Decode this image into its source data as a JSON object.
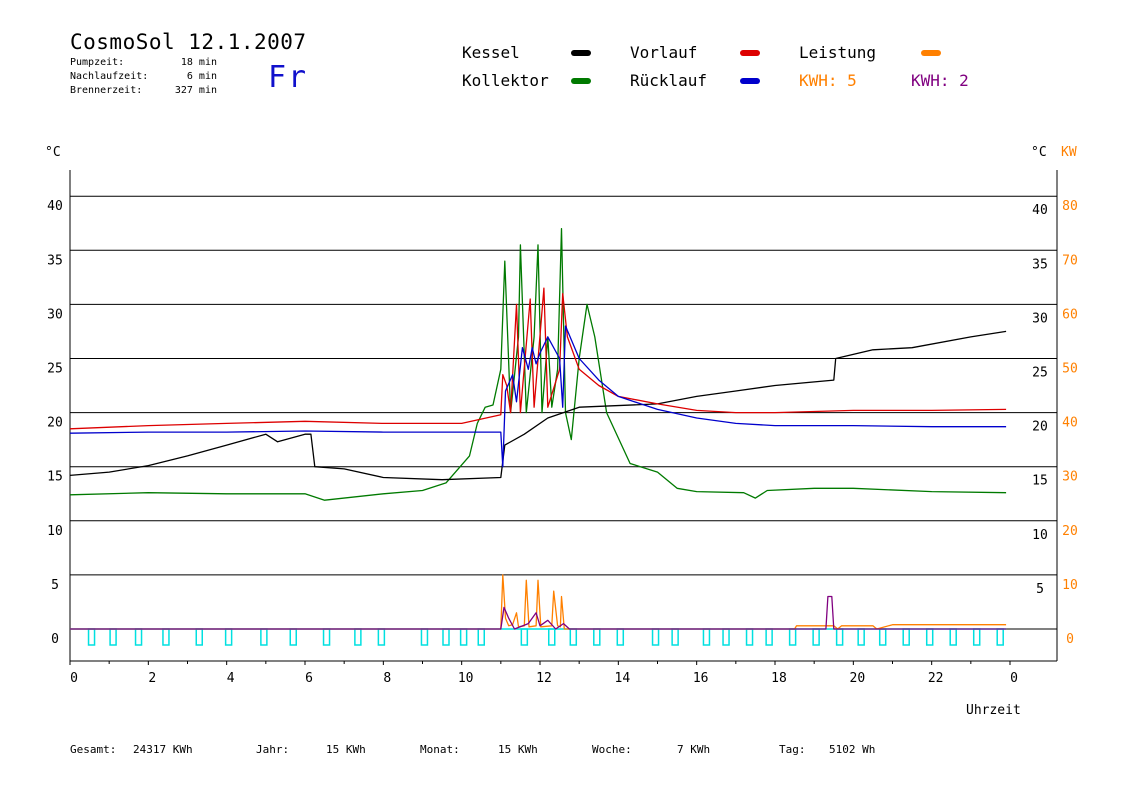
{
  "header": {
    "title": "CosmoSol 12.1.2007",
    "day": "Fr",
    "info": [
      {
        "label": "Pumpzeit:",
        "value": "18 min"
      },
      {
        "label": "Nachlaufzeit:",
        "value": "6 min"
      },
      {
        "label": "Brennerzeit:",
        "value": "327 min"
      }
    ]
  },
  "legend": {
    "kessel": "Kessel",
    "kollektor": "Kollektor",
    "vorlauf": "Vorlauf",
    "ruecklauf": "Rücklauf",
    "leistung": "Leistung",
    "kwh1": "KWH: 5",
    "kwh2": "KWH: 2"
  },
  "footer": {
    "gesamt_label": "Gesamt:",
    "gesamt_value": "24317 KWh",
    "jahr_label": "Jahr:",
    "jahr_value": "15 KWh",
    "monat_label": "Monat:",
    "monat_value": "15 KWh",
    "woche_label": "Woche:",
    "woche_value": "7 KWh",
    "tag_label": "Tag:",
    "tag_value": "5102 Wh"
  },
  "chart_data": {
    "type": "line",
    "xlabel": "Uhrzeit",
    "y_left_unit": "°C",
    "y_right_unit_c": "°C",
    "y_right_unit_kw": "KW",
    "x_ticks": [
      "0",
      "2",
      "4",
      "6",
      "8",
      "10",
      "12",
      "14",
      "16",
      "18",
      "20",
      "22",
      "0"
    ],
    "y_left_ticks": [
      "0",
      "5",
      "10",
      "15",
      "20",
      "25",
      "30",
      "35",
      "40"
    ],
    "y_right_c_ticks": [
      "5",
      "10",
      "15",
      "20",
      "25",
      "30",
      "35",
      "40"
    ],
    "y_right_kw_ticks": [
      "0",
      "10",
      "20",
      "30",
      "40",
      "50",
      "60",
      "70",
      "80"
    ],
    "xlim": [
      0,
      24
    ],
    "ylim": [
      0,
      40
    ],
    "colors": {
      "kessel": "#000000",
      "kollektor": "#007a00",
      "vorlauf": "#dd0000",
      "ruecklauf": "#0000cc",
      "leistung": "#ff8000",
      "kwh2": "#800080",
      "pumpe": "#00e0e0"
    },
    "series": [
      {
        "name": "Kessel",
        "key": "kessel",
        "points": [
          [
            0,
            14.2
          ],
          [
            1,
            14.5
          ],
          [
            2,
            15.1
          ],
          [
            3,
            16
          ],
          [
            4,
            17
          ],
          [
            5,
            18
          ],
          [
            5.3,
            17.3
          ],
          [
            6,
            18
          ],
          [
            6.15,
            18
          ],
          [
            6.25,
            15
          ],
          [
            7,
            14.8
          ],
          [
            8,
            14
          ],
          [
            9.5,
            13.8
          ],
          [
            11,
            14
          ],
          [
            11.1,
            17
          ],
          [
            11.6,
            18
          ],
          [
            12.2,
            19.5
          ],
          [
            12.6,
            20
          ],
          [
            13,
            20.5
          ],
          [
            15,
            20.8
          ],
          [
            16,
            21.5
          ],
          [
            17,
            22
          ],
          [
            18,
            22.5
          ],
          [
            19.5,
            23
          ],
          [
            19.55,
            25
          ],
          [
            20.5,
            25.8
          ],
          [
            21.5,
            26
          ],
          [
            23,
            27
          ],
          [
            23.9,
            27.5
          ]
        ]
      },
      {
        "name": "Kollektor",
        "key": "kollektor",
        "points": [
          [
            0,
            12.4
          ],
          [
            2,
            12.6
          ],
          [
            4,
            12.5
          ],
          [
            6,
            12.5
          ],
          [
            6.5,
            11.9
          ],
          [
            8,
            12.5
          ],
          [
            9,
            12.8
          ],
          [
            9.6,
            13.5
          ],
          [
            10.2,
            16
          ],
          [
            10.4,
            19
          ],
          [
            10.6,
            20.5
          ],
          [
            10.8,
            20.7
          ],
          [
            11,
            24
          ],
          [
            11.1,
            34
          ],
          [
            11.25,
            20
          ],
          [
            11.45,
            27
          ],
          [
            11.5,
            35.5
          ],
          [
            11.65,
            20
          ],
          [
            11.85,
            27
          ],
          [
            11.95,
            35.5
          ],
          [
            12.05,
            20
          ],
          [
            12.2,
            27
          ],
          [
            12.3,
            20.5
          ],
          [
            12.45,
            24
          ],
          [
            12.55,
            37
          ],
          [
            12.65,
            20
          ],
          [
            12.8,
            17.5
          ],
          [
            13,
            25
          ],
          [
            13.2,
            30
          ],
          [
            13.4,
            27
          ],
          [
            13.7,
            20
          ],
          [
            14.3,
            15.3
          ],
          [
            15,
            14.5
          ],
          [
            15.5,
            13
          ],
          [
            16,
            12.7
          ],
          [
            17.2,
            12.6
          ],
          [
            17.5,
            12.1
          ],
          [
            17.8,
            12.8
          ],
          [
            19,
            13
          ],
          [
            20,
            13
          ],
          [
            22,
            12.7
          ],
          [
            23.9,
            12.6
          ]
        ]
      },
      {
        "name": "Vorlauf",
        "key": "vorlauf",
        "points": [
          [
            0,
            18.5
          ],
          [
            2,
            18.8
          ],
          [
            4,
            19
          ],
          [
            6,
            19.2
          ],
          [
            8,
            19
          ],
          [
            10,
            19
          ],
          [
            11,
            19.8
          ],
          [
            11.05,
            23.5
          ],
          [
            11.15,
            22.5
          ],
          [
            11.25,
            20
          ],
          [
            11.4,
            30
          ],
          [
            11.5,
            20
          ],
          [
            11.75,
            30.5
          ],
          [
            11.85,
            20.5
          ],
          [
            12.1,
            31.5
          ],
          [
            12.2,
            20.5
          ],
          [
            12.5,
            24
          ],
          [
            12.58,
            31
          ],
          [
            12.7,
            27
          ],
          [
            13,
            24
          ],
          [
            13.5,
            22.5
          ],
          [
            14,
            21.5
          ],
          [
            15,
            20.8
          ],
          [
            16,
            20.2
          ],
          [
            17,
            20
          ],
          [
            18,
            20
          ],
          [
            20,
            20.2
          ],
          [
            22,
            20.2
          ],
          [
            23.9,
            20.3
          ]
        ]
      },
      {
        "name": "Rücklauf",
        "key": "ruecklauf",
        "points": [
          [
            0,
            18.1
          ],
          [
            2,
            18.2
          ],
          [
            4,
            18.2
          ],
          [
            6,
            18.3
          ],
          [
            8,
            18.2
          ],
          [
            10,
            18.2
          ],
          [
            11,
            18.2
          ],
          [
            11.05,
            15
          ],
          [
            11.12,
            22
          ],
          [
            11.3,
            23.5
          ],
          [
            11.4,
            21
          ],
          [
            11.55,
            26
          ],
          [
            11.7,
            24
          ],
          [
            11.8,
            26
          ],
          [
            11.9,
            24.5
          ],
          [
            12,
            25.5
          ],
          [
            12.2,
            27
          ],
          [
            12.5,
            25
          ],
          [
            12.58,
            20.5
          ],
          [
            12.65,
            28
          ],
          [
            13,
            25
          ],
          [
            13.5,
            23
          ],
          [
            14,
            21.5
          ],
          [
            15,
            20.3
          ],
          [
            16,
            19.5
          ],
          [
            17,
            19
          ],
          [
            18,
            18.8
          ],
          [
            20,
            18.8
          ],
          [
            22,
            18.7
          ],
          [
            23.9,
            18.7
          ]
        ]
      },
      {
        "name": "Leistung",
        "key": "leistung",
        "points": [
          [
            0,
            0
          ],
          [
            11,
            0
          ],
          [
            11.05,
            5
          ],
          [
            11.12,
            1
          ],
          [
            11.2,
            0.3
          ],
          [
            11.3,
            0.4
          ],
          [
            11.4,
            1.5
          ],
          [
            11.45,
            0.2
          ],
          [
            11.6,
            0.3
          ],
          [
            11.65,
            4.5
          ],
          [
            11.72,
            0.2
          ],
          [
            11.9,
            0.3
          ],
          [
            11.95,
            4.5
          ],
          [
            12.02,
            0.2
          ],
          [
            12.3,
            0.3
          ],
          [
            12.35,
            3.5
          ],
          [
            12.45,
            0.3
          ],
          [
            12.52,
            0.2
          ],
          [
            12.55,
            3
          ],
          [
            12.62,
            0
          ],
          [
            18.5,
            0
          ],
          [
            18.55,
            0.3
          ],
          [
            19.5,
            0.3
          ],
          [
            19.6,
            0
          ],
          [
            19.7,
            0.3
          ],
          [
            20.5,
            0.3
          ],
          [
            20.6,
            0
          ],
          [
            21,
            0.4
          ],
          [
            23.9,
            0.4
          ]
        ]
      },
      {
        "name": "KWH",
        "key": "kwh2",
        "points": [
          [
            0,
            0
          ],
          [
            11,
            0
          ],
          [
            11.08,
            2
          ],
          [
            11.2,
            1
          ],
          [
            11.35,
            0
          ],
          [
            11.7,
            0.5
          ],
          [
            11.9,
            1.5
          ],
          [
            12,
            0.3
          ],
          [
            12.2,
            0.8
          ],
          [
            12.4,
            0
          ],
          [
            12.6,
            0.5
          ],
          [
            12.75,
            0
          ],
          [
            19.3,
            0
          ],
          [
            19.35,
            3
          ],
          [
            19.45,
            3
          ],
          [
            19.5,
            0
          ],
          [
            23.9,
            0
          ]
        ]
      },
      {
        "name": "Pumpe",
        "key": "pumpe",
        "pulses": [
          0.55,
          1.1,
          1.75,
          2.45,
          3.3,
          4.05,
          4.95,
          5.7,
          6.55,
          7.35,
          7.95,
          9.05,
          9.6,
          10.05,
          10.5,
          11.6,
          12.3,
          12.85,
          13.45,
          14.05,
          14.95,
          15.45,
          16.25,
          16.75,
          17.35,
          17.85,
          18.45,
          19.05,
          19.65,
          20.2,
          20.75,
          21.35,
          21.95,
          22.55,
          23.15,
          23.75
        ]
      }
    ]
  }
}
